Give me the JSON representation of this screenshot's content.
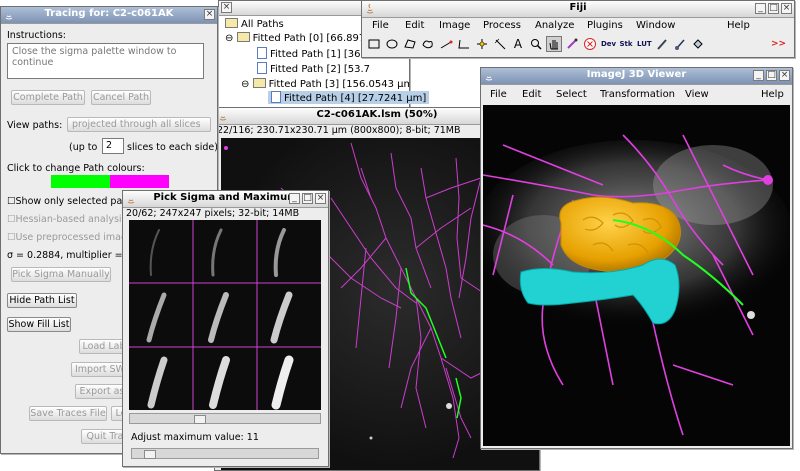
{
  "tracing_window": {
    "title": "Tracing for: C2-c061AK",
    "instructions_label": "Instructions:",
    "instructions_text": "Close the sigma palette window to continue",
    "complete_path": "Complete Path",
    "cancel_path": "Cancel Path",
    "view_paths_label": "View paths:",
    "view_paths_value": "projected through all slices",
    "up_to_label": "(up to",
    "slices_value": "2",
    "slices_suffix": "slices to each side)",
    "click_change_colours": "Click to change Path colours:",
    "colour_selected": "#00ff00",
    "colour_other": "#ff00ff",
    "show_only_selected": "Show only selected pat",
    "hessian_analysis": "Hessian-based analysis",
    "use_preprocessed": "Use preprocessed imag",
    "sigma_line": "σ = 0.2884, multiplier =",
    "pick_sigma_manually": "Pick Sigma Manually",
    "hide_path_list": "Hide Path List",
    "show_fill_list": "Show Fill List",
    "load_labels": "Load Lab",
    "import_swc": "Import SW",
    "export_as": "Export as",
    "save_traces": "Save Traces File",
    "save_traces_extra": "Lo",
    "quit_tracing": "Quit Tra"
  },
  "path_tree": {
    "root": "All Paths",
    "items": [
      "Fitted Path [0] [66.8979",
      "Fitted Path [1] [36.4",
      "Fitted Path [2] [53.7",
      "Fitted Path [3] [156.0543 μm]",
      "Fitted Path [4] [27.7241 μm]"
    ]
  },
  "fiji": {
    "title": "Fiji",
    "menu": [
      "File",
      "Edit",
      "Image",
      "Process",
      "Analyze",
      "Plugins",
      "Window",
      "Help"
    ],
    "tool_labels": {
      "text": "A",
      "dev": "Dev",
      "stk": "Stk",
      "lut": "LUT",
      "more": ">>"
    }
  },
  "image_window": {
    "title": "C2-c061AK.lsm (50%)",
    "info": "22/116; 230.71x230.71 μm (800x800); 8-bit; 71MB"
  },
  "sigma_window": {
    "title": "Pick Sigma and Maximum",
    "info": "20/62; 247x247 pixels; 32-bit; 14MB",
    "adjust_label": "Adjust maximum value: 11"
  },
  "viewer3d": {
    "title": "ImageJ 3D Viewer",
    "menu": [
      "File",
      "Edit",
      "Select",
      "Transformation",
      "View",
      "Help"
    ]
  }
}
